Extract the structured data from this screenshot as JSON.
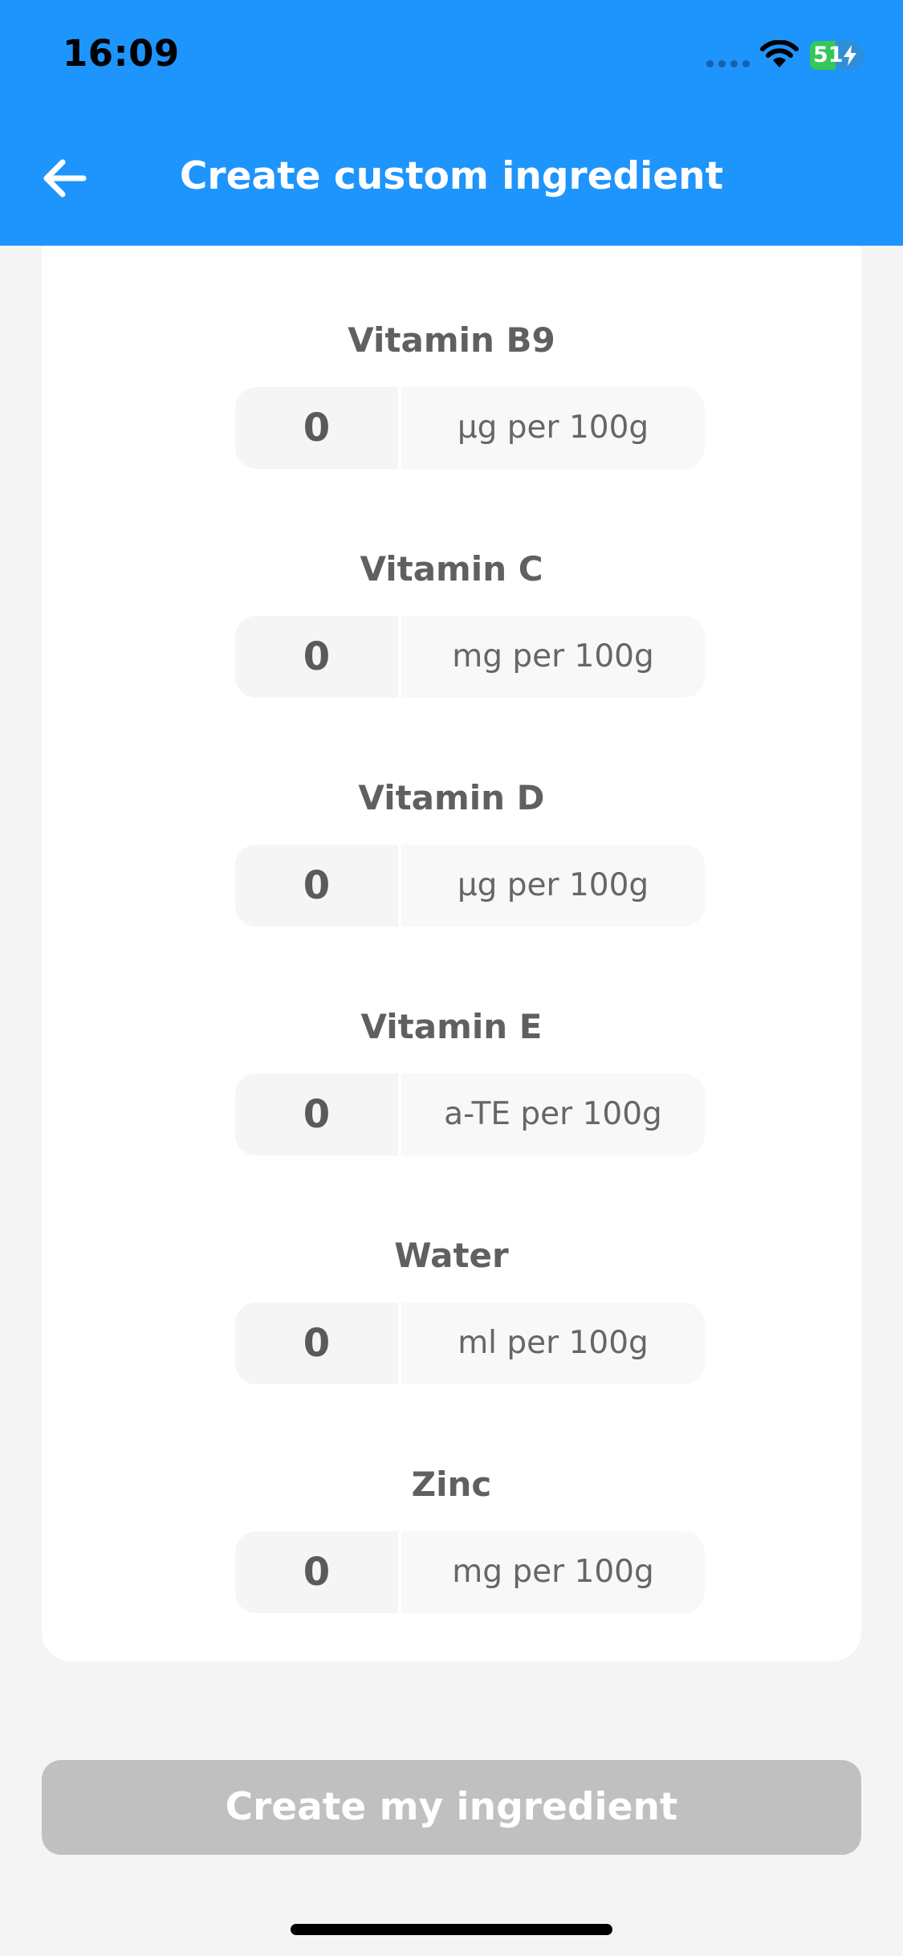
{
  "status_bar": {
    "time": "16:09",
    "battery_level": "51"
  },
  "header": {
    "title": "Create custom ingredient",
    "back_icon": "arrow-left-icon"
  },
  "fields": [
    {
      "label": "Vitamin B9",
      "value": "0",
      "unit": "µg per 100g"
    },
    {
      "label": "Vitamin C",
      "value": "0",
      "unit": "mg per 100g"
    },
    {
      "label": "Vitamin D",
      "value": "0",
      "unit": "µg per 100g"
    },
    {
      "label": "Vitamin E",
      "value": "0",
      "unit": "a-TE per 100g"
    },
    {
      "label": "Water",
      "value": "0",
      "unit": "ml per 100g"
    },
    {
      "label": "Zinc",
      "value": "0",
      "unit": "mg per 100g"
    }
  ],
  "footer": {
    "create_button_label": "Create my ingredient"
  },
  "colors": {
    "header_bg": "#1e94fd",
    "button_disabled": "#c0c0c0",
    "battery_green": "#34c759"
  }
}
